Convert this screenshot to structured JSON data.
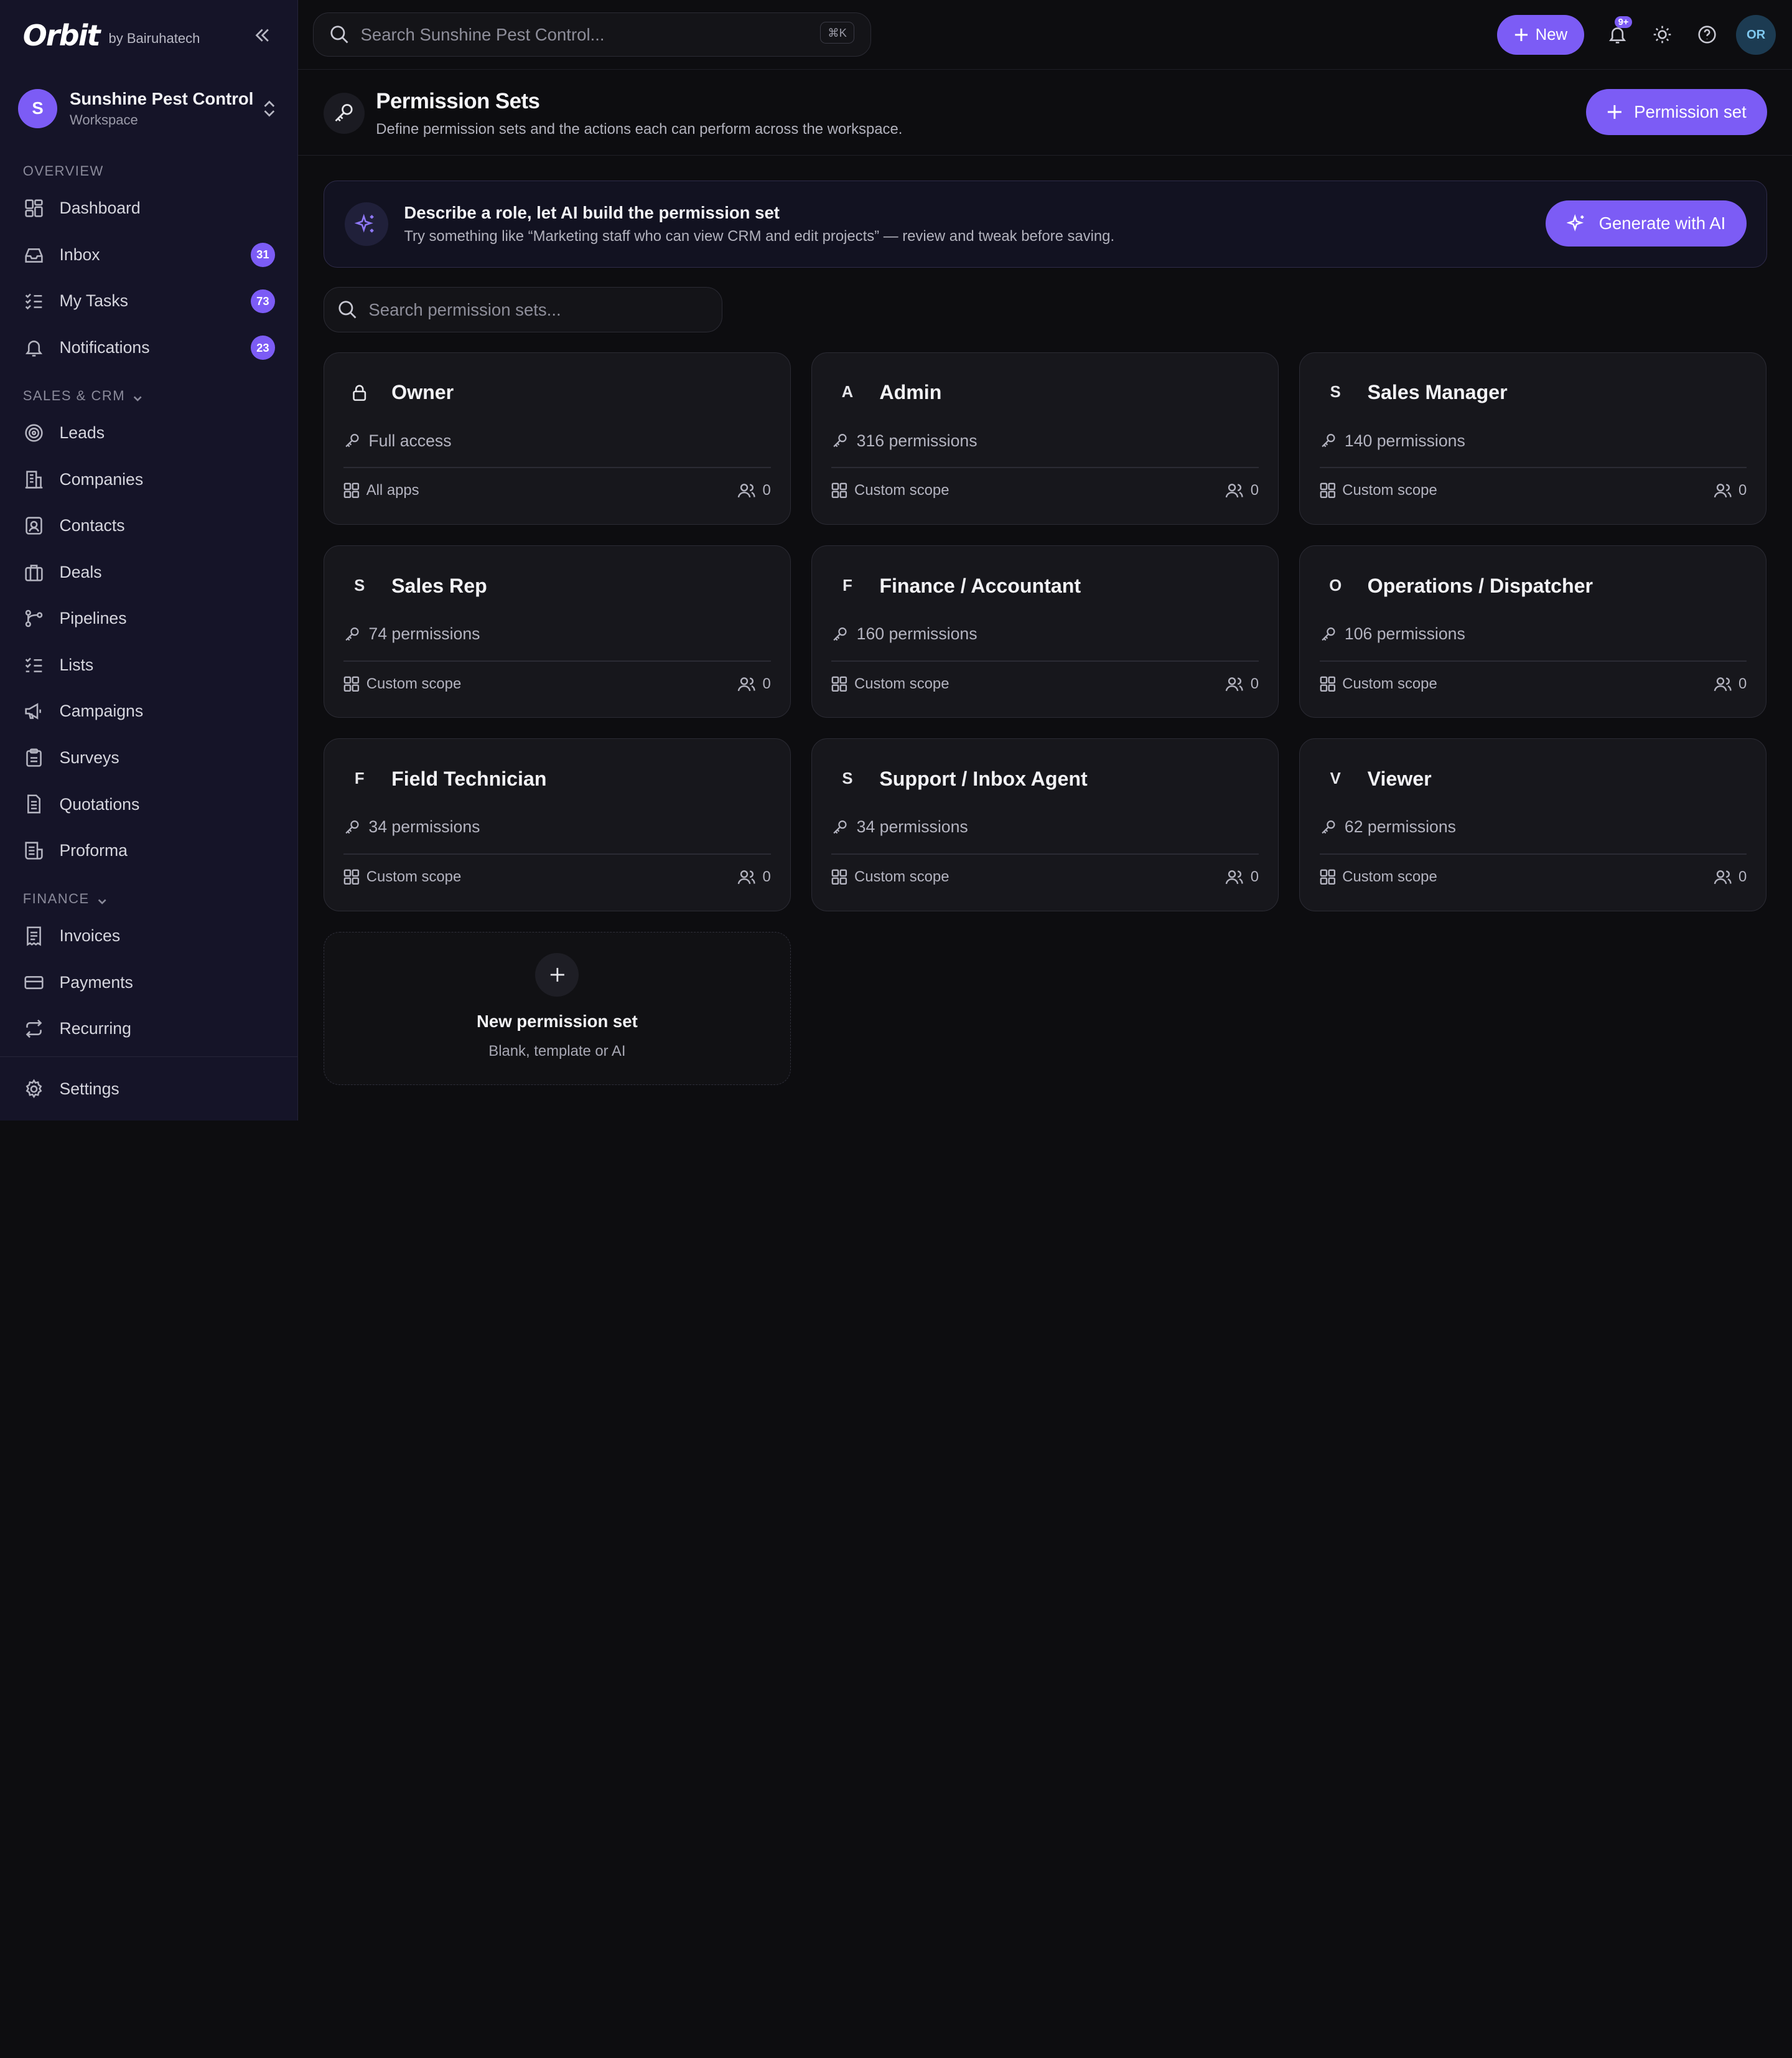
{
  "brand": {
    "logo": "Orbit",
    "by": "by Bairuhatech"
  },
  "workspace": {
    "initial": "S",
    "name": "Sunshine Pest Control",
    "sub": "Workspace"
  },
  "sidebar": {
    "overview_label": "OVERVIEW",
    "overview_items": [
      {
        "label": "Dashboard",
        "icon": "dashboard-icon"
      },
      {
        "label": "Inbox",
        "icon": "inbox-icon",
        "badge": "31"
      },
      {
        "label": "My Tasks",
        "icon": "tasks-icon",
        "badge": "73"
      },
      {
        "label": "Notifications",
        "icon": "bell-icon",
        "badge": "23"
      }
    ],
    "sales_label": "SALES & CRM",
    "sales_items": [
      {
        "label": "Leads",
        "icon": "target-icon"
      },
      {
        "label": "Companies",
        "icon": "building-icon"
      },
      {
        "label": "Contacts",
        "icon": "contact-icon"
      },
      {
        "label": "Deals",
        "icon": "briefcase-icon"
      },
      {
        "label": "Pipelines",
        "icon": "pipeline-icon"
      },
      {
        "label": "Lists",
        "icon": "list-icon"
      },
      {
        "label": "Campaigns",
        "icon": "megaphone-icon"
      },
      {
        "label": "Surveys",
        "icon": "clipboard-icon"
      },
      {
        "label": "Quotations",
        "icon": "document-icon"
      },
      {
        "label": "Proforma",
        "icon": "receipt-icon"
      }
    ],
    "finance_label": "FINANCE",
    "finance_items": [
      {
        "label": "Invoices",
        "icon": "invoice-icon"
      },
      {
        "label": "Payments",
        "icon": "card-icon"
      },
      {
        "label": "Recurring",
        "icon": "repeat-icon"
      }
    ],
    "settings_label": "Settings"
  },
  "topbar": {
    "search_placeholder": "Search Sunshine Pest Control...",
    "search_shortcut": "⌘K",
    "new_label": "New",
    "notif_badge": "9+",
    "user_initials": "OR"
  },
  "header": {
    "title": "Permission Sets",
    "subtitle": "Define permission sets and the actions each can perform across the workspace.",
    "button_label": "Permission set"
  },
  "ai_banner": {
    "title": "Describe a role, let AI build the permission set",
    "subtitle": "Try something like “Marketing staff who can view CRM and edit projects” — review and tweak before saving.",
    "button_label": "Generate with AI"
  },
  "perm_search_placeholder": "Search permission sets...",
  "cards": [
    {
      "letter": "",
      "title": "Owner",
      "perms": "Full access",
      "scope": "All apps",
      "count": "0",
      "lock": true
    },
    {
      "letter": "A",
      "title": "Admin",
      "perms": "316 permissions",
      "scope": "Custom scope",
      "count": "0"
    },
    {
      "letter": "S",
      "title": "Sales Manager",
      "perms": "140 permissions",
      "scope": "Custom scope",
      "count": "0"
    },
    {
      "letter": "S",
      "title": "Sales Rep",
      "perms": "74 permissions",
      "scope": "Custom scope",
      "count": "0"
    },
    {
      "letter": "F",
      "title": "Finance / Accountant",
      "perms": "160 permissions",
      "scope": "Custom scope",
      "count": "0"
    },
    {
      "letter": "O",
      "title": "Operations / Dispatcher",
      "perms": "106 permissions",
      "scope": "Custom scope",
      "count": "0"
    },
    {
      "letter": "F",
      "title": "Field Technician",
      "perms": "34 permissions",
      "scope": "Custom scope",
      "count": "0"
    },
    {
      "letter": "S",
      "title": "Support / Inbox Agent",
      "perms": "34 permissions",
      "scope": "Custom scope",
      "count": "0"
    },
    {
      "letter": "V",
      "title": "Viewer",
      "perms": "62 permissions",
      "scope": "Custom scope",
      "count": "0"
    }
  ],
  "new_card": {
    "title": "New permission set",
    "subtitle": "Blank, template or AI"
  },
  "colors": {
    "accent": "#7c5cf5",
    "sidebar_bg": "#151428",
    "main_bg": "#0d0d10",
    "card_bg": "#17171c"
  }
}
